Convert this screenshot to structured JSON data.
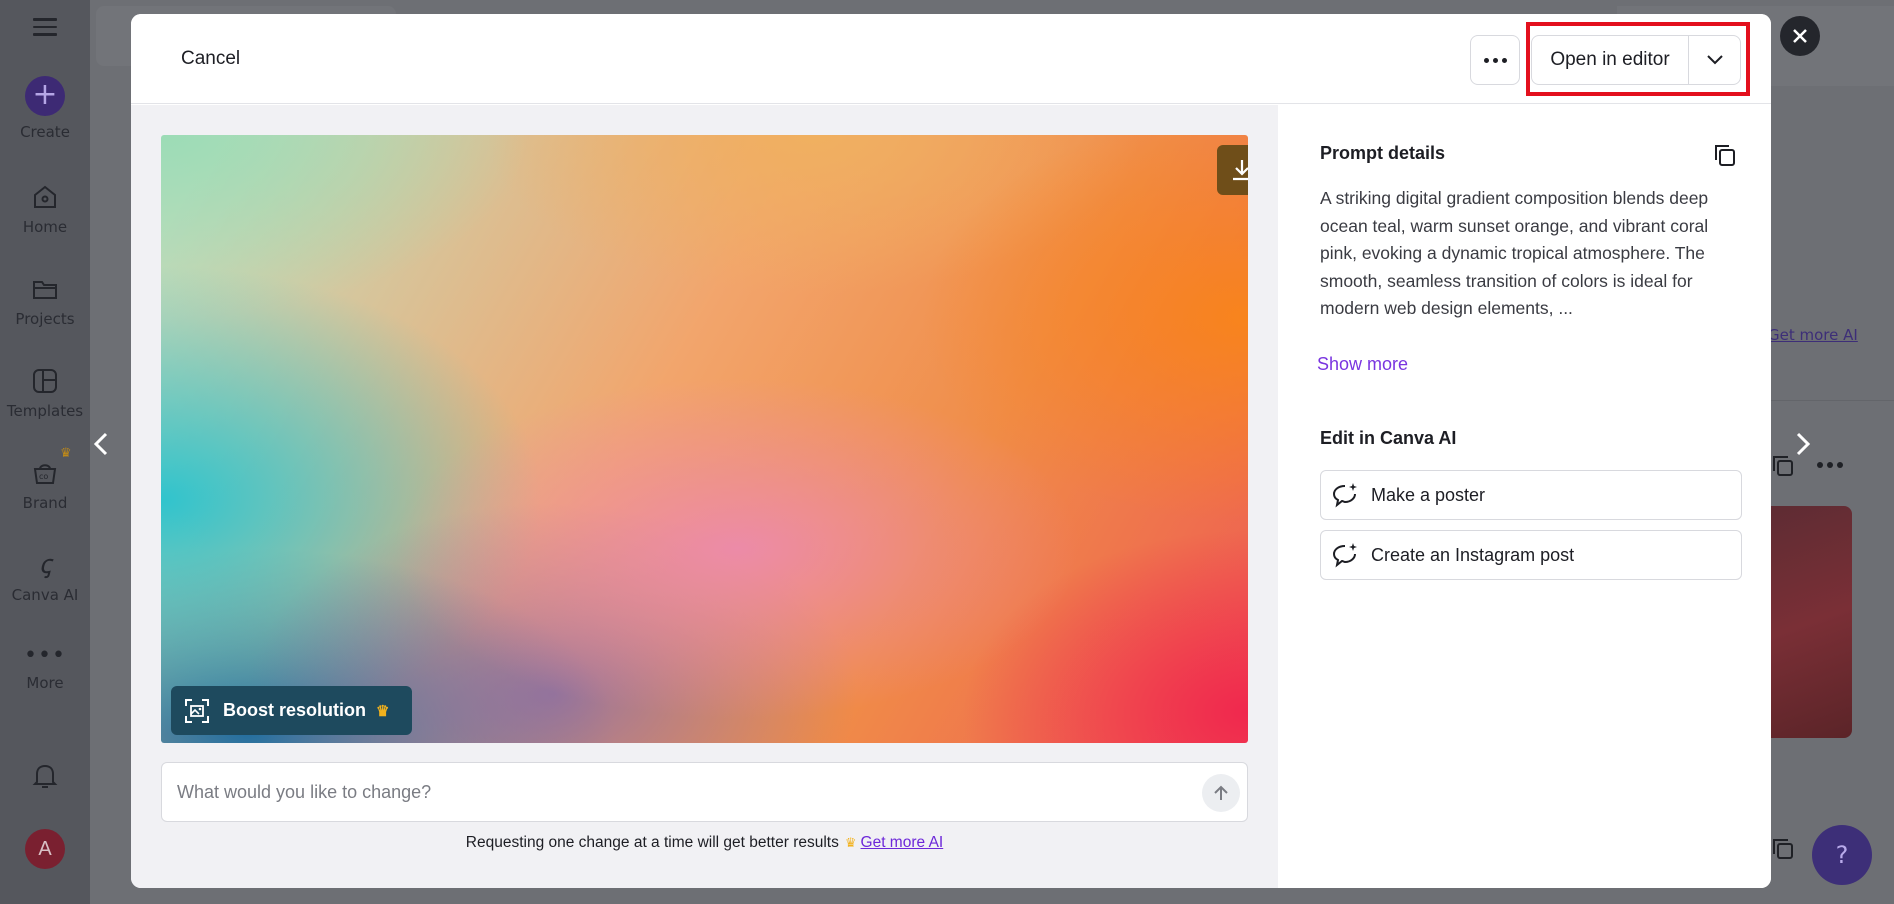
{
  "sidebar": {
    "create_label": "Create",
    "items": [
      {
        "label": "Home",
        "icon": "home-icon"
      },
      {
        "label": "Projects",
        "icon": "folder-icon"
      },
      {
        "label": "Templates",
        "icon": "templates-icon"
      },
      {
        "label": "Brand",
        "icon": "brand-icon"
      },
      {
        "label": "Canva AI",
        "icon": "canva-ai-icon"
      },
      {
        "label": "More",
        "icon": "more-dots-icon"
      }
    ],
    "avatar_letter": "A"
  },
  "background": {
    "get_more_ai_link": "Get more AI",
    "help_label": "?"
  },
  "modal": {
    "cancel_label": "Cancel",
    "open_in_editor_label": "Open in editor",
    "boost_label": "Boost resolution",
    "input_placeholder": "What would you like to change?",
    "hint_text": "Requesting one change at a time will get better results",
    "hint_link": "Get more AI",
    "prompt_title": "Prompt details",
    "prompt_text": "A striking digital gradient composition blends deep ocean teal, warm sunset orange, and vibrant coral pink, evoking a dynamic tropical atmosphere. The smooth, seamless transition of colors is ideal for modern web design elements, ...",
    "show_more_label": "Show more",
    "edit_title": "Edit in Canva AI",
    "actions": [
      {
        "label": "Make a poster",
        "icon": "chat-sparkle-icon"
      },
      {
        "label": "Create an Instagram post",
        "icon": "chat-sparkle-icon"
      }
    ]
  },
  "colors": {
    "accent_purple": "#7a35e0",
    "highlight_red": "#e3101d",
    "crown_gold": "#f2b21d"
  }
}
